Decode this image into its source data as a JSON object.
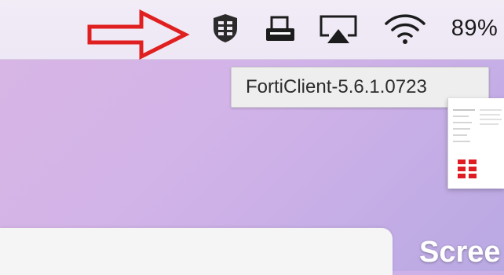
{
  "menubar": {
    "icons": [
      {
        "name": "forticlient-shield-icon"
      },
      {
        "name": "printer-icon"
      },
      {
        "name": "airplay-icon"
      },
      {
        "name": "wifi-icon"
      }
    ],
    "battery_percent": "89%"
  },
  "annotation": {
    "arrow_color": "#e02020"
  },
  "tooltip": {
    "text": "FortiClient-5.6.1.0723"
  },
  "desktop": {
    "label": "Scree"
  }
}
